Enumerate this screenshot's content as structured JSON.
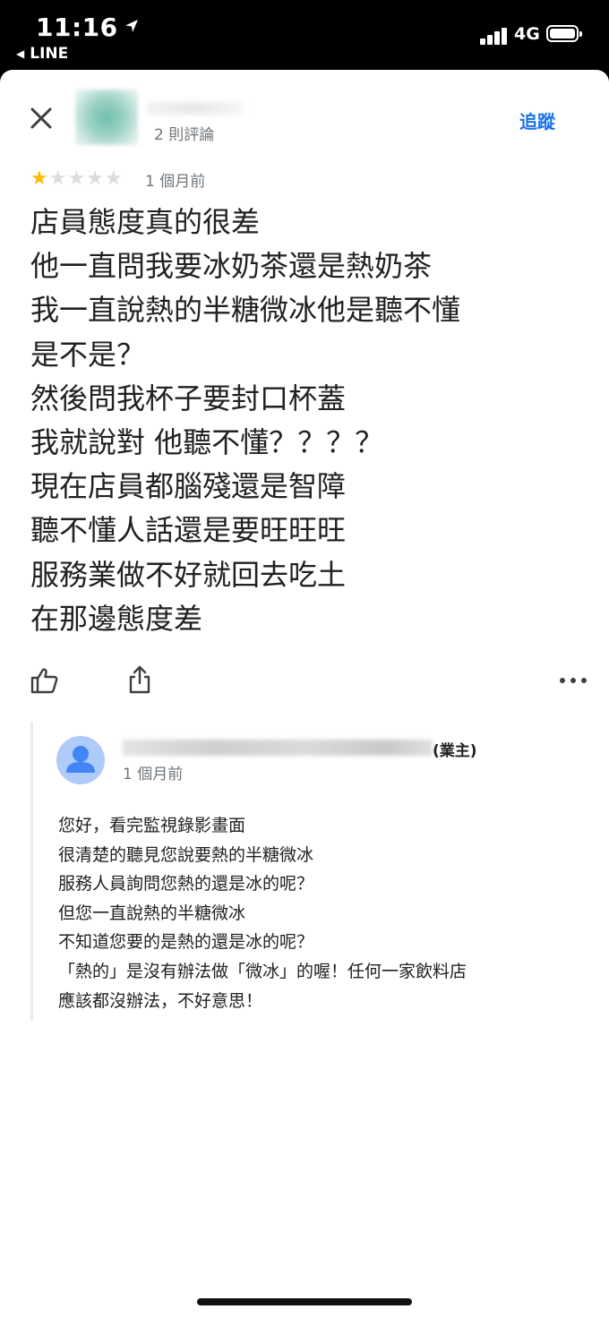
{
  "status_bar": {
    "time": "11:16",
    "back_app": "LINE",
    "network": "4G"
  },
  "header": {
    "review_count": "2 則評論",
    "follow_label": "追蹤"
  },
  "review": {
    "rating": 1,
    "max_rating": 5,
    "time": "1 個月前",
    "lines": [
      "店員態度真的很差",
      "他一直問我要冰奶茶還是熱奶茶",
      "我一直說熱的半糖微冰他是聽不懂",
      "是不是？",
      "然後問我杯子要封口杯蓋",
      "我就說對 他聽不懂？？？？",
      "現在店員都腦殘還是智障",
      "聽不懂人話還是要旺旺旺",
      "服務業做不好就回去吃土",
      "在那邊態度差"
    ]
  },
  "owner_reply": {
    "owner_tag": "(業主)",
    "time": "1 個月前",
    "lines": [
      "您好，看完監視錄影畫面",
      "很清楚的聽見您說要熱的半糖微冰",
      "服務人員詢問您熱的還是冰的呢？",
      "但您一直說熱的半糖微冰",
      "不知道您要的是熱的還是冰的呢？",
      "「熱的」是沒有辦法做「微冰」的喔！任何一家飲料店",
      "應該都沒辦法，不好意思！"
    ]
  },
  "colors": {
    "accent": "#1a73e8",
    "star_on": "#fbbc04",
    "star_off": "#dadce0",
    "secondary_text": "#70757a"
  },
  "icons": [
    "location-arrow-icon",
    "signal-icon",
    "battery-icon",
    "close-icon",
    "star-icon",
    "thumbs-up-icon",
    "share-icon",
    "more-icon",
    "person-icon"
  ]
}
